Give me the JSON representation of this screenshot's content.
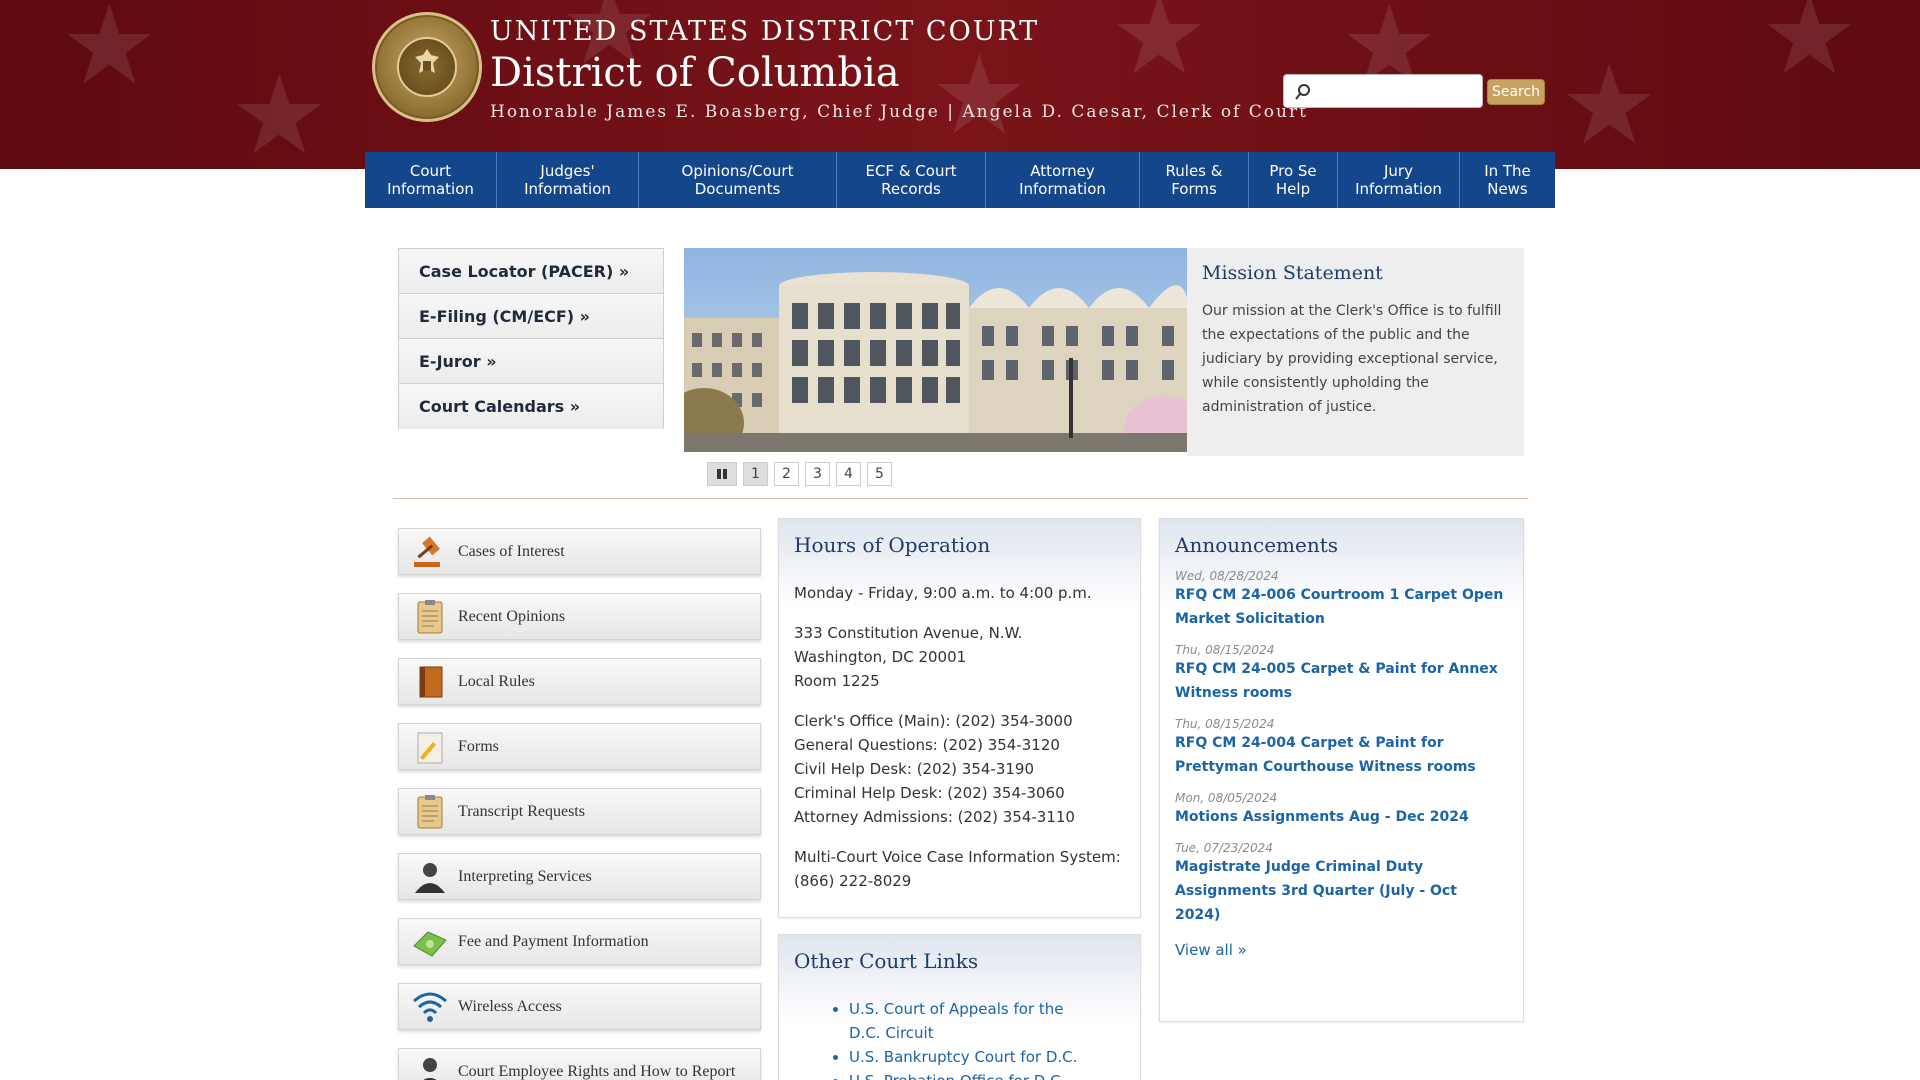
{
  "header": {
    "court_name": "UNITED STATES DISTRICT COURT",
    "district": "District of Columbia",
    "officials": "Honorable James E. Boasberg, Chief Judge | Angela D. Caesar, Clerk of Court",
    "seal_icon": "court-seal-icon"
  },
  "search": {
    "placeholder": "",
    "button_label": "Search"
  },
  "nav": [
    {
      "l1": "Court",
      "l2": "Information"
    },
    {
      "l1": "Judges'",
      "l2": "Information"
    },
    {
      "l1": "Opinions/Court",
      "l2": "Documents"
    },
    {
      "l1": "ECF & Court",
      "l2": "Records"
    },
    {
      "l1": "Attorney",
      "l2": "Information"
    },
    {
      "l1": "Rules &",
      "l2": "Forms"
    },
    {
      "l1": "Pro Se",
      "l2": "Help"
    },
    {
      "l1": "Jury",
      "l2": "Information"
    },
    {
      "l1": "In The",
      "l2": "News"
    }
  ],
  "quick_links": [
    "Case Locator (PACER) »",
    "E-Filing (CM/ECF) »",
    "E-Juror »",
    "Court Calendars »"
  ],
  "slideshow": {
    "mission_title": "Mission Statement",
    "mission_text": "Our mission at the Clerk's Office is to fulfill the expectations of the public and the judiciary by providing exceptional service, while consistently upholding the administration of justice.",
    "pages": [
      "1",
      "2",
      "3",
      "4",
      "5"
    ],
    "active_page": "1"
  },
  "resources": [
    {
      "label": "Cases of Interest",
      "icon": "gavel-icon"
    },
    {
      "label": "Recent Opinions",
      "icon": "clipboard-icon"
    },
    {
      "label": "Local Rules",
      "icon": "book-icon"
    },
    {
      "label": "Forms",
      "icon": "form-pencil-icon"
    },
    {
      "label": "Transcript Requests",
      "icon": "clipboard-icon"
    },
    {
      "label": "Interpreting Services",
      "icon": "person-icon"
    },
    {
      "label": "Fee and Payment Information",
      "icon": "money-icon"
    },
    {
      "label": "Wireless Access",
      "icon": "wifi-icon"
    },
    {
      "label": "Court Employee Rights and How to Report",
      "icon": "person-icon"
    }
  ],
  "hours": {
    "title": "Hours of Operation",
    "schedule": "Monday - Friday, 9:00 a.m. to 4:00 p.m.",
    "address1": "333 Constitution Avenue, N.W.",
    "address2": "Washington, DC 20001",
    "room": "Room 1225",
    "phones": [
      "Clerk's Office (Main): (202) 354-3000",
      "General Questions: (202) 354-3120",
      "Civil Help Desk: (202) 354-3190",
      "Criminal Help Desk: (202) 354-3060",
      "Attorney Admissions: (202) 354-3110"
    ],
    "voice1": "Multi-Court Voice Case Information System:",
    "voice2": "(866) 222-8029"
  },
  "other_links": {
    "title": "Other Court Links",
    "items": [
      "U.S. Court of Appeals for the D.C. Circuit",
      "U.S. Bankruptcy Court for D.C.",
      "U.S. Probation Office for D.C."
    ]
  },
  "announcements": {
    "title": "Announcements",
    "items": [
      {
        "date": "Wed, 08/28/2024",
        "text": "RFQ CM 24-006 Courtroom 1 Carpet Open Market Solicitation"
      },
      {
        "date": "Thu, 08/15/2024",
        "text": "RFQ CM 24-005 Carpet & Paint for Annex Witness rooms"
      },
      {
        "date": "Thu, 08/15/2024",
        "text": "RFQ CM 24-004 Carpet & Paint for Prettyman Courthouse Witness rooms"
      },
      {
        "date": "Mon, 08/05/2024",
        "text": "Motions Assignments Aug - Dec 2024"
      },
      {
        "date": "Tue, 07/23/2024",
        "text": "Magistrate Judge Criminal Duty Assignments 3rd Quarter (July - Oct 2024)"
      }
    ],
    "view_all": "View all »"
  },
  "colors": {
    "header_bg": "#6e0f13",
    "nav_bg": "#14468c",
    "link": "#1b64a6",
    "search_button": "#c8a35f"
  }
}
